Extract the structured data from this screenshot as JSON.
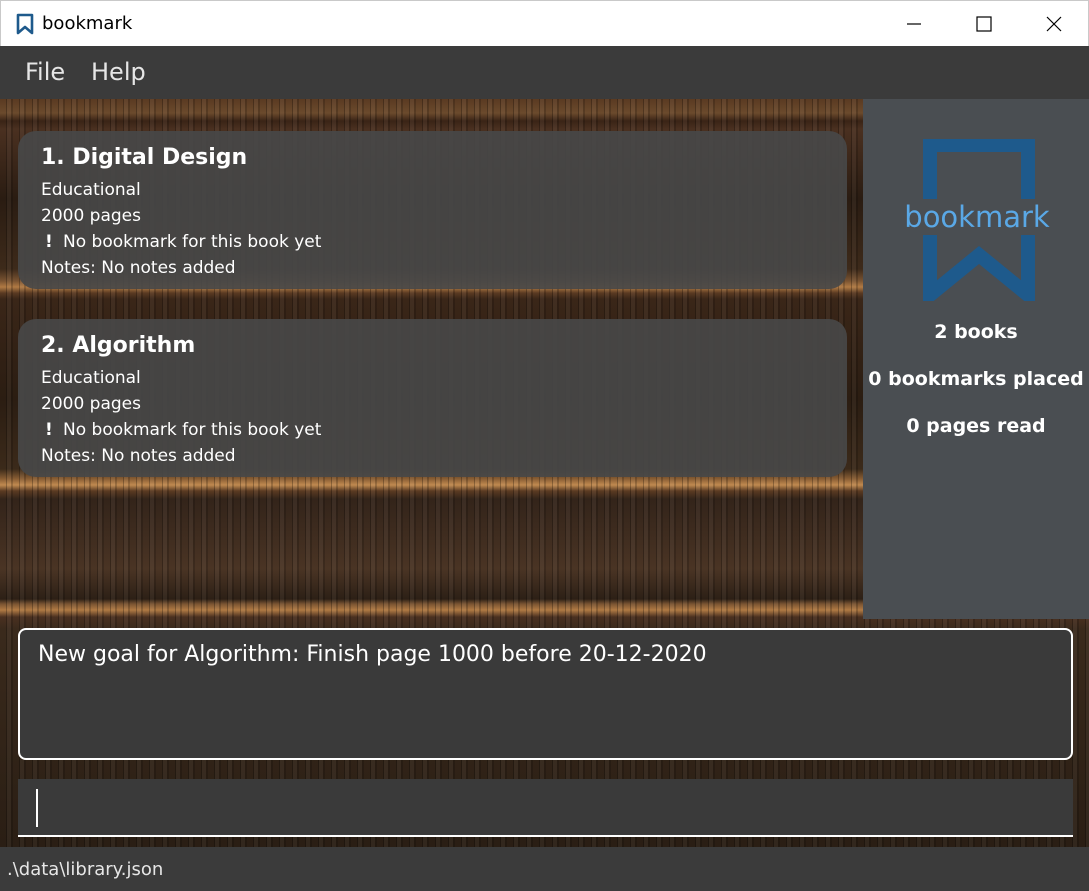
{
  "window": {
    "title": "bookmark",
    "icon": "bookmark-icon",
    "controls": [
      "minimize-icon",
      "maximize-icon",
      "close-icon"
    ]
  },
  "menu": {
    "file": "File",
    "help": "Help"
  },
  "books": [
    {
      "title": "1.  Digital Design",
      "genre": "Educational",
      "pages": "2000 pages",
      "bookmark_status": "No bookmark for this book yet",
      "notes": "Notes: No notes added"
    },
    {
      "title": "2.  Algorithm",
      "genre": "Educational",
      "pages": "2000 pages",
      "bookmark_status": "No bookmark for this book yet",
      "notes": "Notes: No notes added"
    }
  ],
  "warning_glyph": "!",
  "stats": {
    "logo_text": "bookmark",
    "books": "2 books",
    "bookmarks": "0 bookmarks placed",
    "pages_read": "0 pages read"
  },
  "result": {
    "text": "New goal for Algorithm: Finish page 1000 before 20-12-2020"
  },
  "command": {
    "value": ""
  },
  "status": {
    "path": ".\\data\\library.json"
  },
  "colors": {
    "logo_blue": "#1e5a8c",
    "logo_text": "#5aa8e6",
    "stats_bg": "#4a4e52",
    "card_bg": "#484848"
  }
}
